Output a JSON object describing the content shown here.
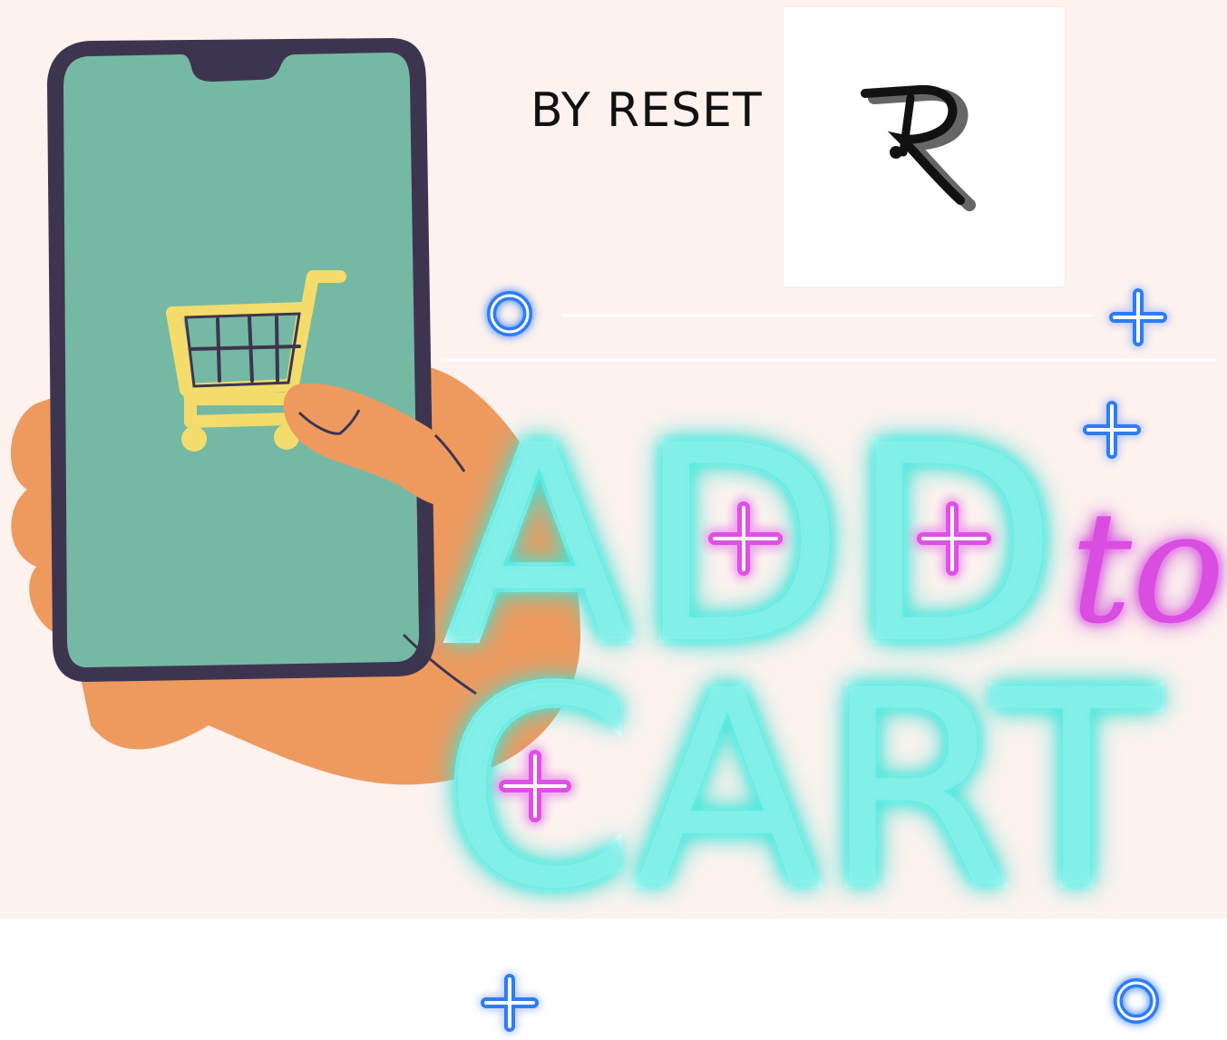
{
  "byline": "BY RESET",
  "logo": {
    "letter": "R",
    "name": "reset-logo"
  },
  "neon": {
    "line1": "ADD",
    "connector": "to",
    "line2": "CART"
  },
  "colors": {
    "background": "#fdf2ee",
    "neon_cyan": "#5ff2e8",
    "neon_magenta": "#e04fe6",
    "neon_blue": "#2f7cf6",
    "phone_frame": "#3d3550",
    "phone_screen": "#75b9a4",
    "hand": "#ee9a5f",
    "cart": "#f3dc6c"
  },
  "icons": [
    "shopping-cart-icon",
    "plus-icon",
    "circle-icon"
  ]
}
